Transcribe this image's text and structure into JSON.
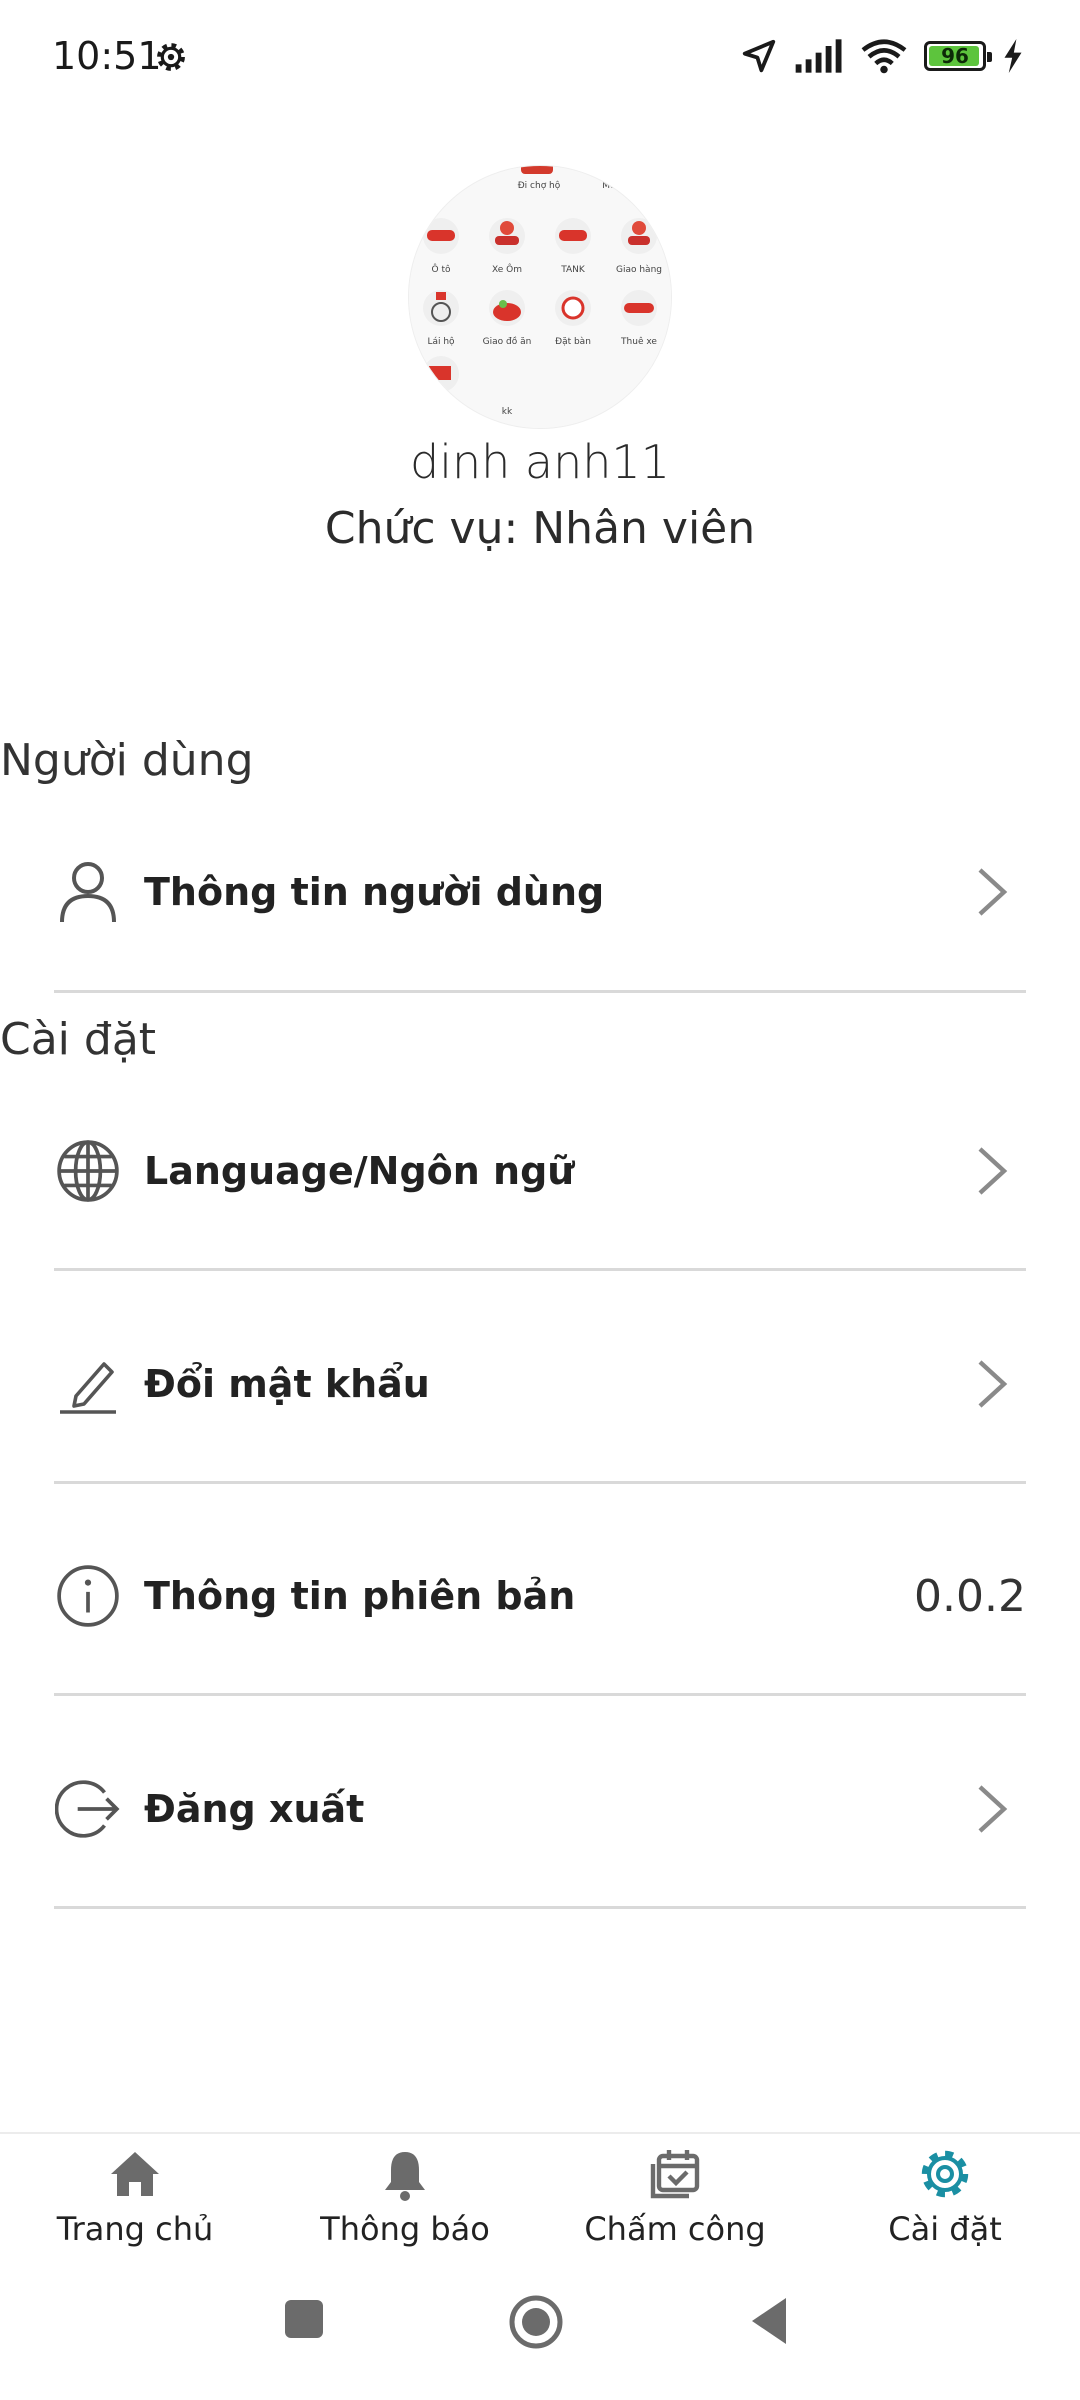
{
  "status_bar": {
    "time": "10:51",
    "battery_level": 96,
    "battery_label": "96",
    "icons": [
      "settings-gear-icon",
      "location-arrow-icon",
      "cell-signal-icon",
      "wifi-icon",
      "battery-icon",
      "charging-bolt-icon"
    ]
  },
  "profile": {
    "name": "dinh anh11",
    "role": "Chức vụ: Nhân viên",
    "avatar_labels": [
      "Đi chợ hộ",
      "Mu",
      "Ô tô",
      "Xe Ôm",
      "TANK",
      "Giao hàng",
      "Lái hộ",
      "Giao đồ ăn",
      "Đặt bàn",
      "Thuê xe",
      "kk"
    ]
  },
  "sections": {
    "user_title": "Người dùng",
    "settings_title": "Cài đặt"
  },
  "rows": {
    "user_info": "Thông tin người dùng",
    "language": "Language/Ngôn ngữ",
    "change_password": "Đổi mật khẩu",
    "version_label": "Thông tin phiên bản",
    "version_value": "0.0.2",
    "logout": "Đăng xuất"
  },
  "bottom_nav": {
    "home": "Trang chủ",
    "notifications": "Thông báo",
    "attendance": "Chấm công",
    "settings": "Cài đặt",
    "active": "settings"
  },
  "colors": {
    "accent": "#1a8fa3",
    "divider": "#d9d9d9",
    "icon_gray": "#555555",
    "chevron_gray": "#8a8a8a",
    "battery_green": "#5dc43d"
  }
}
